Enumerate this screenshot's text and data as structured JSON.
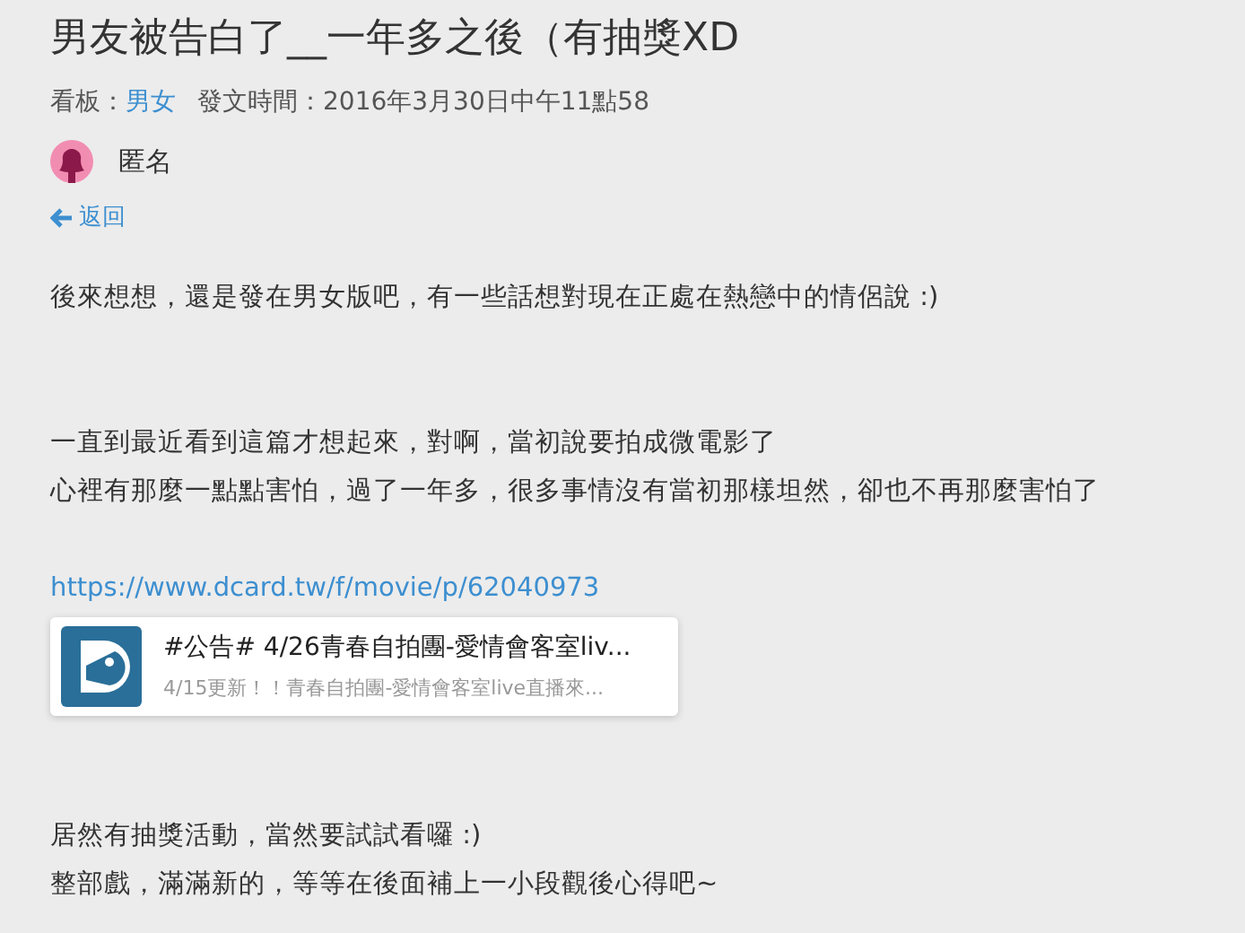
{
  "post": {
    "title": "男友被告白了__一年多之後（有抽獎XD",
    "board_label": "看板：",
    "board": "男女",
    "time": "發文時間：2016年3月30日中午11點58",
    "author": "匿名",
    "back": "返回"
  },
  "body": [
    {
      "kind": "text",
      "lines": [
        "後來想想，還是發在男女版吧，有一些話想對現在正處在熱戀中的情侶說 :)"
      ]
    },
    {
      "kind": "text",
      "lines": [
        "一直到最近看到這篇才想起來，對啊，當初說要拍成微電影了",
        "心裡有那麼一點點害怕，過了一年多，很多事情沒有當初那樣坦然，卻也不再那麼害怕了"
      ]
    },
    {
      "kind": "link",
      "text": "https://www.dcard.tw/f/movie/p/62040973"
    },
    {
      "kind": "card",
      "title": "#公告# 4/26青春自拍團-愛情會客室liv...",
      "excerpt": "4/15更新！！青春自拍團-愛情會客室live直播來..."
    },
    {
      "kind": "text",
      "lines": [
        "居然有抽獎活動，當然要試試看囉 :)",
        "整部戲，滿滿新的，等等在後面補上一小段觀後心得吧~"
      ]
    }
  ]
}
